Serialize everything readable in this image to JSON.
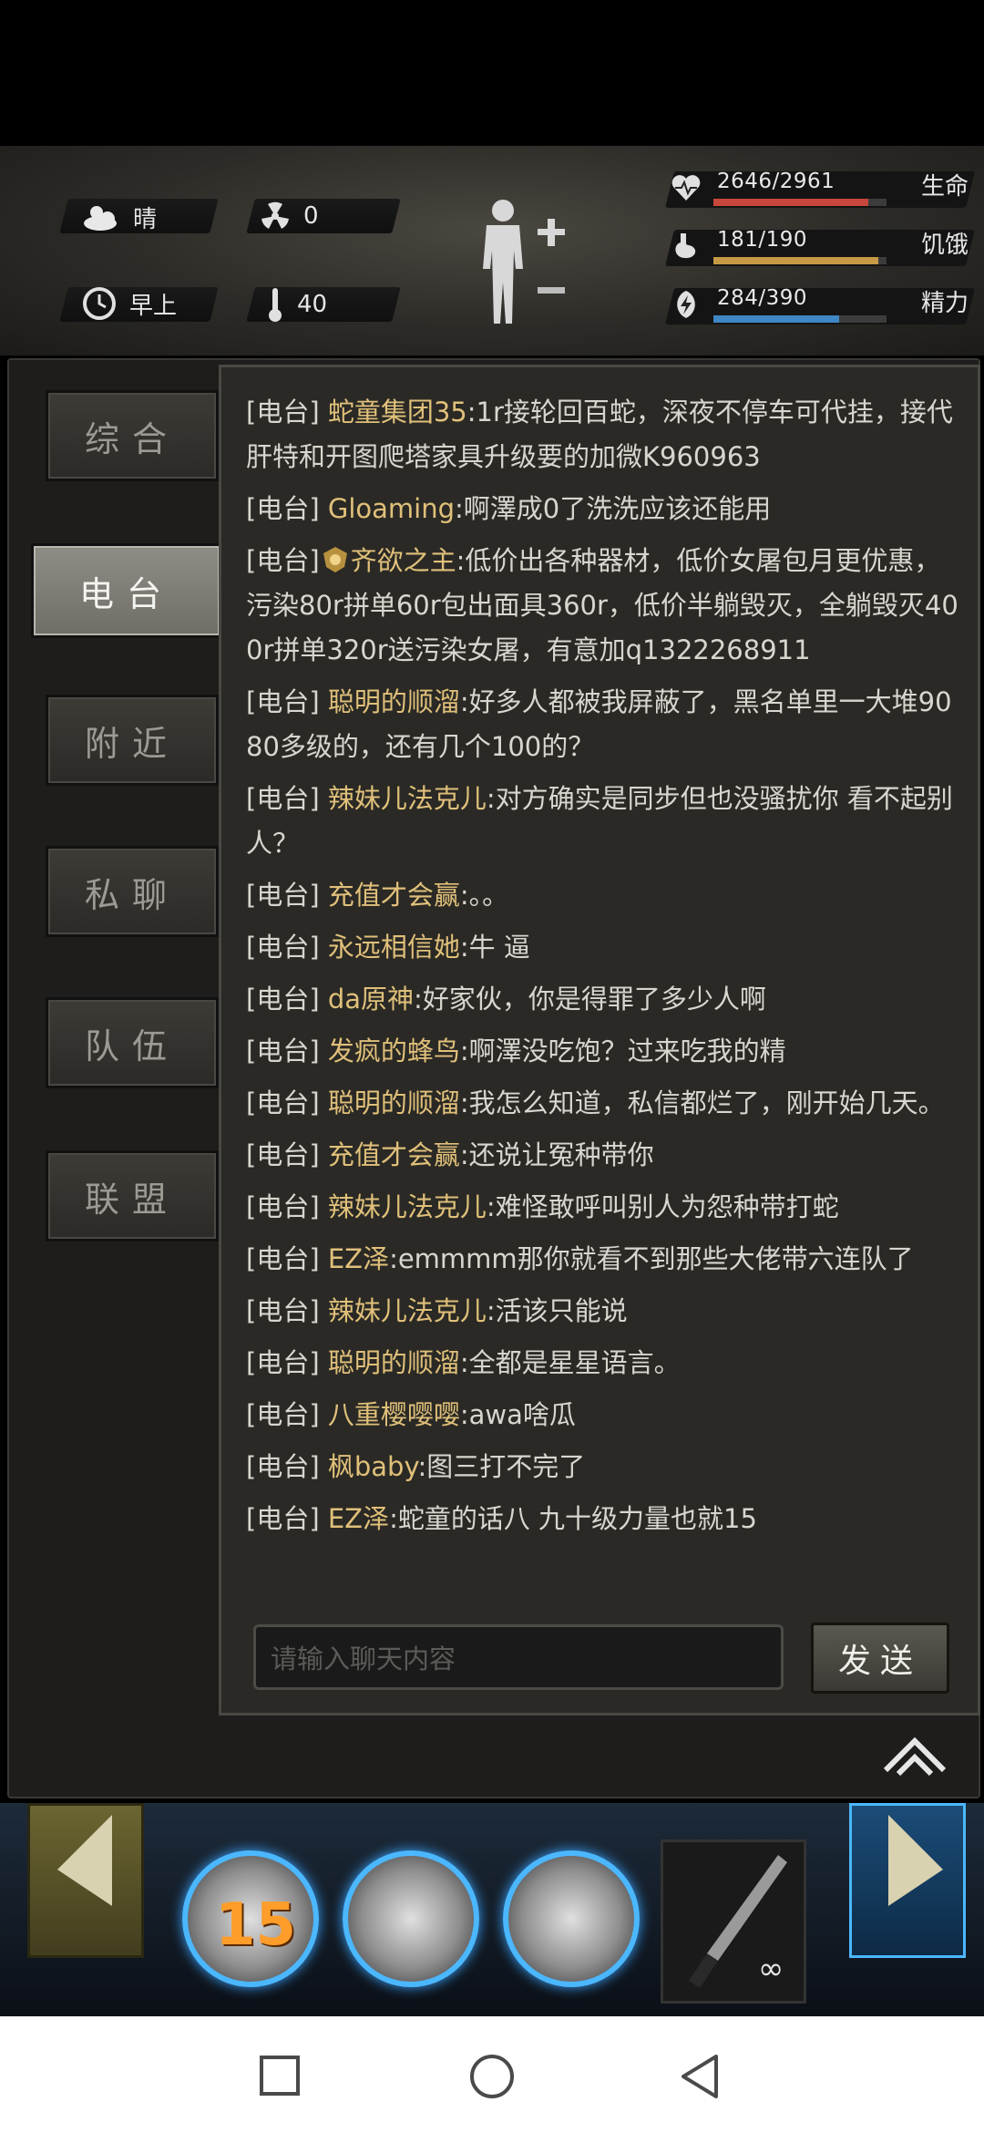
{
  "hud": {
    "weather": "晴",
    "radiation": "0",
    "time_of_day": "早上",
    "temperature": "40",
    "stats": [
      {
        "icon": "heart-icon",
        "value": "2646/2961",
        "label": "生命",
        "fraction": 0.894,
        "color": "#c8473b"
      },
      {
        "icon": "stomach-icon",
        "value": "181/190",
        "label": "饥饿",
        "fraction": 0.953,
        "color": "#c79a45"
      },
      {
        "icon": "energy-icon",
        "value": "284/390",
        "label": "精力",
        "fraction": 0.728,
        "color": "#3f86c4"
      }
    ]
  },
  "tabs": [
    {
      "label": "综合",
      "active": false
    },
    {
      "label": "电台",
      "active": true
    },
    {
      "label": "附近",
      "active": false
    },
    {
      "label": "私聊",
      "active": false
    },
    {
      "label": "队伍",
      "active": false
    },
    {
      "label": "联盟",
      "active": false
    }
  ],
  "chat": {
    "channel_tag": "[电台]",
    "messages": [
      {
        "name": "蛇童集团35",
        "text": ":1r接轮回百蛇，深夜不停车可代挂，接代肝特和开图爬塔家具升级要的加微K960963"
      },
      {
        "name": "Gloaming",
        "text": ":啊澤成0了洗洗应该还能用"
      },
      {
        "name": "齐欲之主",
        "text": ":低价出各种器材，低价女屠包月更优惠，污染80r拼单60r包出面具360r，低价半躺毁灭，全躺毁灭400r拼单320r送污染女屠，有意加q1322268911",
        "badge": true
      },
      {
        "name": "聪明的顺溜",
        "text": ":好多人都被我屏蔽了，黑名单里一大堆90 80多级的，还有几个100的？"
      },
      {
        "name": "辣妹儿法克儿",
        "text": ":对方确实是同步但也没骚扰你 看不起别人？"
      },
      {
        "name": "充值才会赢",
        "text": ":。。"
      },
      {
        "name": "永远相信她",
        "text": ":牛 逼"
      },
      {
        "name": "da原神",
        "text": ":好家伙，你是得罪了多少人啊"
      },
      {
        "name": "发疯的蜂鸟",
        "text": ":啊澤没吃饱？过来吃我的精"
      },
      {
        "name": "聪明的顺溜",
        "text": ":我怎么知道，私信都烂了，刚开始几天。"
      },
      {
        "name": "充值才会赢",
        "text": ":还说让冤种带你"
      },
      {
        "name": "辣妹儿法克儿",
        "text": ":难怪敢呼叫别人为怨种带打蛇"
      },
      {
        "name": "EZ泽",
        "text": ":emmmm那你就看不到那些大佬带六连队了"
      },
      {
        "name": "辣妹儿法克儿",
        "text": ":活该只能说"
      },
      {
        "name": "聪明的顺溜",
        "text": ":全都是星星语言。"
      },
      {
        "name": "八重樱嘤嘤",
        "text": ":awa啥瓜"
      },
      {
        "name": "枫baby",
        "text": ":图三打不完了"
      },
      {
        "name": "EZ泽",
        "text": ":蛇童的话八 九十级力量也就15"
      }
    ],
    "input_placeholder": "请输入聊天内容",
    "send_label": "发送"
  },
  "gamebar": {
    "skill_level": "15",
    "weapon_count": "∞"
  },
  "colors": {
    "name": "#e0c07a",
    "accent_blue": "#4bb7ff"
  }
}
